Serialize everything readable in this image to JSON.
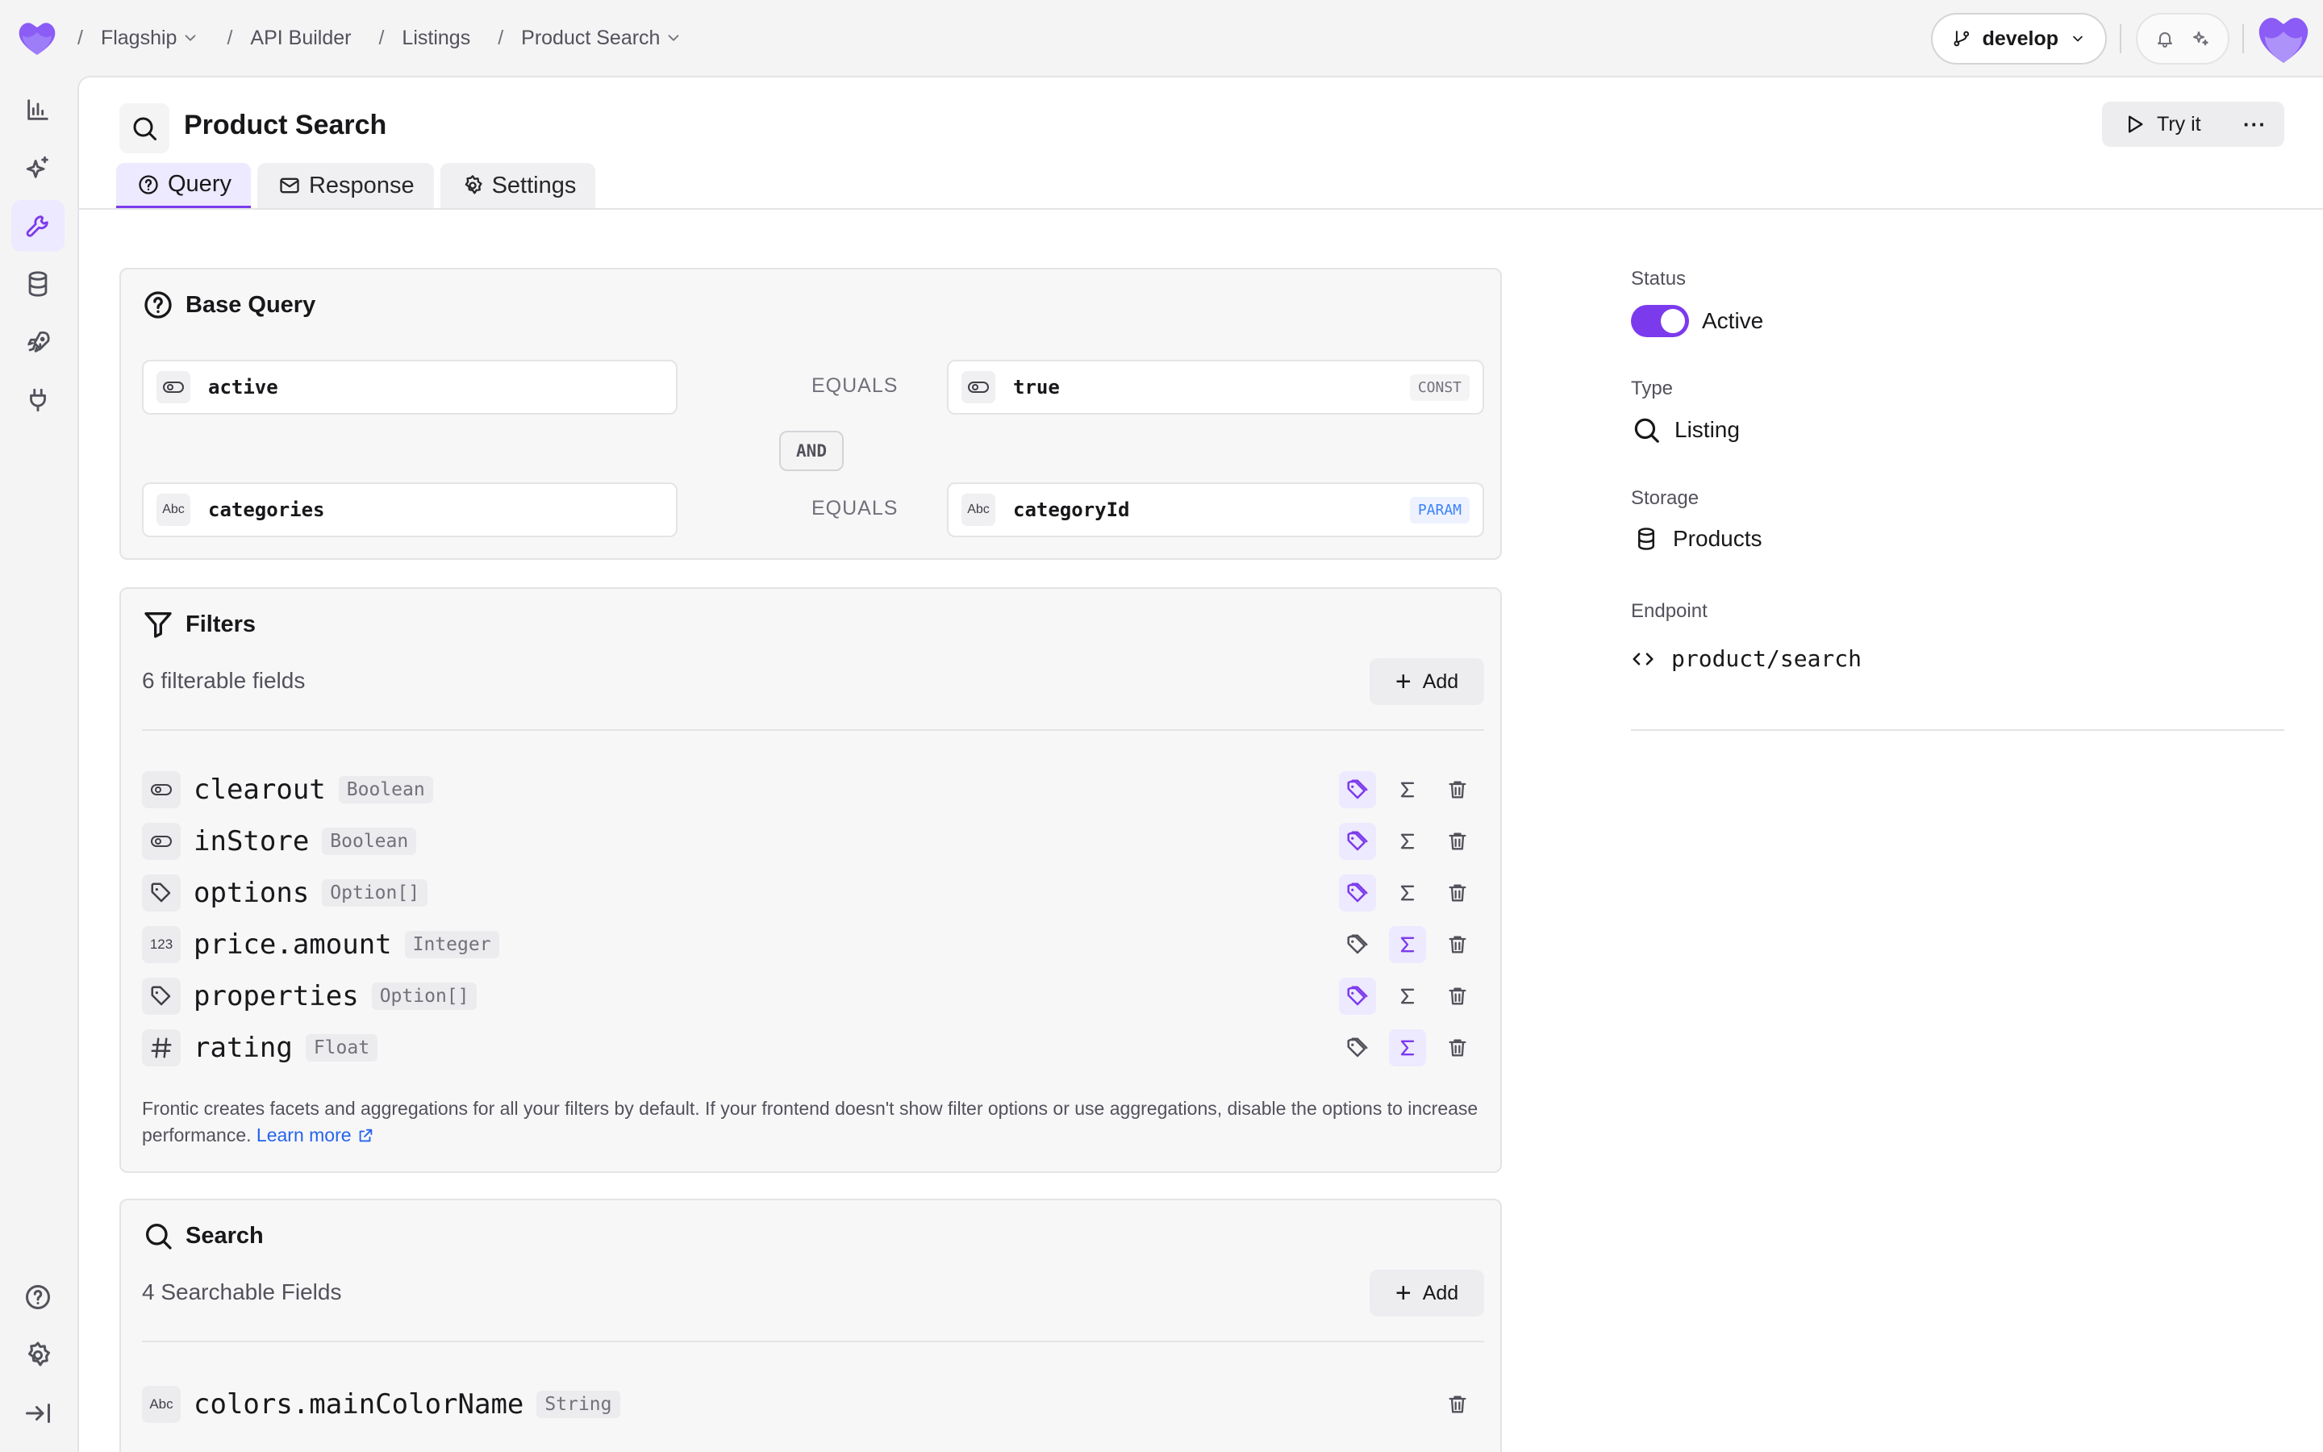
{
  "breadcrumb": {
    "items": [
      "Flagship",
      "API Builder",
      "Listings",
      "Product Search"
    ],
    "separator": "/"
  },
  "branch": {
    "name": "develop"
  },
  "header": {
    "title": "Product Search",
    "try_label": "Try it",
    "more_label": "···"
  },
  "tabs": [
    {
      "label": "Query"
    },
    {
      "label": "Response"
    },
    {
      "label": "Settings"
    }
  ],
  "base_query": {
    "title": "Base Query",
    "rows": [
      {
        "left": "active",
        "left_type": "toggle",
        "operator": "EQUALS",
        "right": "true",
        "right_type": "toggle",
        "right_tag": "CONST"
      },
      {
        "left": "categories",
        "left_type": "Abc",
        "operator": "EQUALS",
        "right": "categoryId",
        "right_type": "Abc",
        "right_tag": "PARAM"
      }
    ],
    "joiner": "AND"
  },
  "filters": {
    "title": "Filters",
    "count_label": "6 filterable fields",
    "add_label": "Add",
    "fields": [
      {
        "name": "clearout",
        "type": "Boolean",
        "icon": "toggle-icon",
        "facet": true,
        "agg": false
      },
      {
        "name": "inStore",
        "type": "Boolean",
        "icon": "toggle-icon",
        "facet": true,
        "agg": false
      },
      {
        "name": "options",
        "type": "Option[]",
        "icon": "tag-icon",
        "facet": true,
        "agg": false
      },
      {
        "name": "price.amount",
        "type": "Integer",
        "icon": "123",
        "facet": false,
        "agg": true
      },
      {
        "name": "properties",
        "type": "Option[]",
        "icon": "tag-icon",
        "facet": true,
        "agg": false
      },
      {
        "name": "rating",
        "type": "Float",
        "icon": "hash-icon",
        "facet": false,
        "agg": true
      }
    ],
    "note": "Frontic creates facets and aggregations for all your filters by default. If your frontend doesn't show filter options or use aggregations, disable the options to increase performance.",
    "learn_more": "Learn more"
  },
  "search": {
    "title": "Search",
    "count_label": "4 Searchable Fields",
    "add_label": "Add",
    "fields": [
      {
        "name": "colors.mainColorName",
        "type": "String",
        "icon": "Abc"
      }
    ]
  },
  "details": {
    "status_label": "Status",
    "status_value": "Active",
    "status_on": true,
    "type_label": "Type",
    "type_value": "Listing",
    "storage_label": "Storage",
    "storage_value": "Products",
    "endpoint_label": "Endpoint",
    "endpoint_value": "product/search"
  },
  "colors": {
    "accent": "#7c3aed",
    "accent_light": "#ede9fe",
    "link": "#2563eb"
  }
}
